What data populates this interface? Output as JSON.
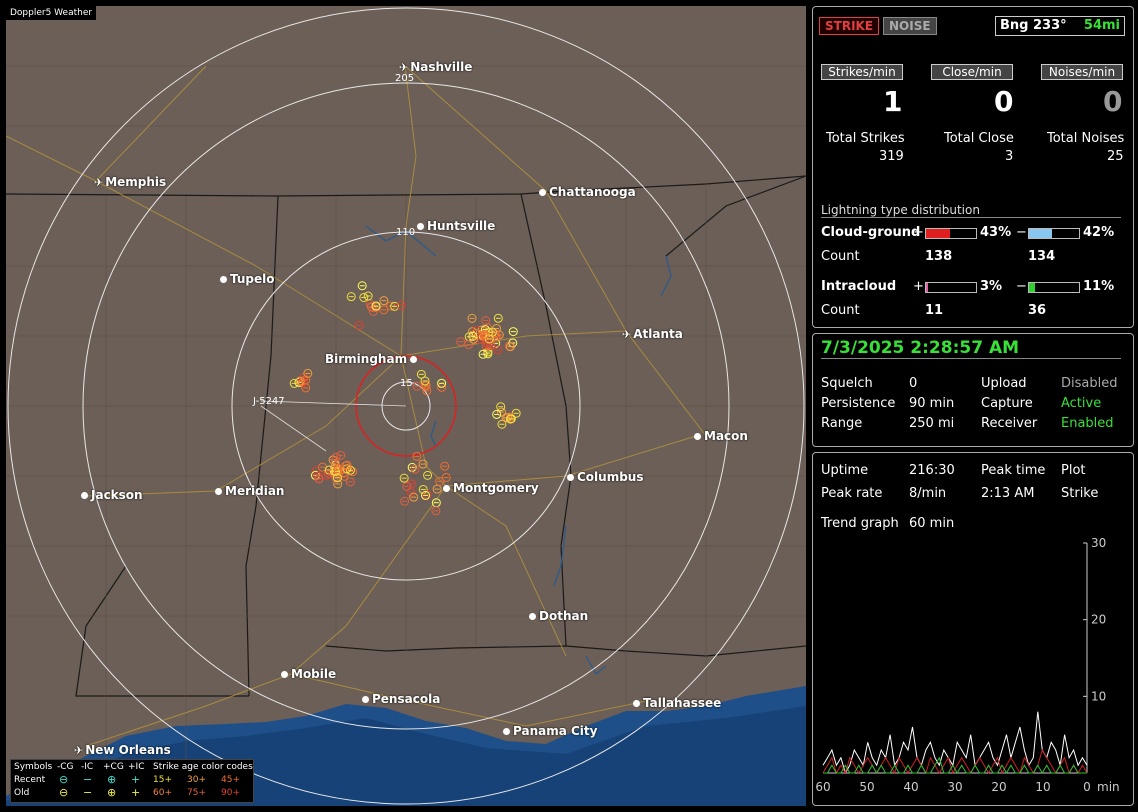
{
  "map": {
    "title": "Doppler5 Weather",
    "ring_labels": {
      "r205": "205",
      "r110": "110",
      "r15": "15"
    },
    "marker_label": "J-5247",
    "cities": [
      {
        "name": "Nashville",
        "kind": "airport"
      },
      {
        "name": "Memphis",
        "kind": "airport"
      },
      {
        "name": "Chattanooga",
        "kind": "city"
      },
      {
        "name": "Huntsville",
        "kind": "city"
      },
      {
        "name": "Tupelo",
        "kind": "city"
      },
      {
        "name": "Atlanta",
        "kind": "airport"
      },
      {
        "name": "Birmingham",
        "kind": "city"
      },
      {
        "name": "Macon",
        "kind": "city"
      },
      {
        "name": "Jackson",
        "kind": "city"
      },
      {
        "name": "Meridian",
        "kind": "city"
      },
      {
        "name": "Montgomery",
        "kind": "city"
      },
      {
        "name": "Columbus",
        "kind": "city"
      },
      {
        "name": "Dothan",
        "kind": "city"
      },
      {
        "name": "Mobile",
        "kind": "city"
      },
      {
        "name": "Pensacola",
        "kind": "city"
      },
      {
        "name": "Tallahassee",
        "kind": "city"
      },
      {
        "name": "Panama City",
        "kind": "city"
      },
      {
        "name": "New Orleans",
        "kind": "airport"
      }
    ],
    "legend": {
      "symbols": "Symbols",
      "neg_cg": "-CG",
      "neg_ic": "-IC",
      "pos_cg": "+CG",
      "pos_ic": "+IC",
      "age_title": "Strike age color codes",
      "recent": "Recent",
      "old": "Old",
      "recent_ages": [
        "15+",
        "30+",
        "45+"
      ],
      "old_ages": [
        "60+",
        "75+",
        "90+"
      ],
      "colors": {
        "recent": "#3fe0d0",
        "old": "#f0f040",
        "a15": "#f0e040",
        "a30": "#f0a040",
        "a45": "#f07030",
        "a60": "#f08040",
        "a75": "#e06040",
        "a90": "#e04030"
      }
    }
  },
  "top": {
    "strike": "STRIKE",
    "noise": "NOISE",
    "bearing": "Bng 233°",
    "distance": "54mi",
    "strikes_hdr": "Strikes/min",
    "close_hdr": "Close/min",
    "noises_hdr": "Noises/min",
    "strikes_val": "1",
    "close_val": "0",
    "noises_val": "0",
    "total_strikes_lbl": "Total Strikes",
    "total_close_lbl": "Total Close",
    "total_noises_lbl": "Total Noises",
    "total_strikes": "319",
    "total_close": "3",
    "total_noises": "25",
    "dist_title": "Lightning type distribution",
    "cg_lbl": "Cloud-ground",
    "ic_lbl": "Intracloud",
    "count_lbl": "Count",
    "plus": "+",
    "minus": "−",
    "cg_pos_pct": "43%",
    "cg_neg_pct": "42%",
    "cg_pos_count": "138",
    "cg_neg_count": "134",
    "ic_pos_pct": "3%",
    "ic_neg_pct": "11%",
    "ic_pos_count": "11",
    "ic_neg_count": "36",
    "cg_pos_frac": 0.43,
    "cg_neg_frac": 0.42,
    "ic_pos_frac": 0.03,
    "ic_neg_frac": 0.11
  },
  "status": {
    "datetime": "7/3/2025 2:28:57 AM",
    "squelch_lbl": "Squelch",
    "squelch": "0",
    "persistence_lbl": "Persistence",
    "persistence": "90 min",
    "range_lbl": "Range",
    "range": "250 mi",
    "upload_lbl": "Upload",
    "upload": "Disabled",
    "capture_lbl": "Capture",
    "capture": "Active",
    "receiver_lbl": "Receiver",
    "receiver": "Enabled"
  },
  "stats": {
    "uptime_lbl": "Uptime",
    "uptime": "216:30",
    "peak_time_lbl": "Peak time",
    "peak_time": "2:13 AM",
    "plot_lbl": "Plot",
    "plot": "Strike",
    "peak_rate_lbl": "Peak rate",
    "peak_rate": "8/min",
    "trend_lbl": "Trend graph",
    "trend": "60 min"
  },
  "chart_data": {
    "type": "line",
    "x_ticks": [
      "60",
      "50",
      "40",
      "30",
      "20",
      "10",
      "0"
    ],
    "x_unit": "min",
    "y_ticks": [
      "30",
      "20",
      "10"
    ],
    "ylim": [
      0,
      30
    ],
    "xlim": [
      60,
      0
    ],
    "series": [
      {
        "color": "#ffffff",
        "values": [
          1,
          2,
          3,
          1,
          2,
          0,
          1,
          3,
          2,
          1,
          4,
          2,
          1,
          3,
          2,
          5,
          1,
          2,
          4,
          3,
          6,
          2,
          1,
          3,
          4,
          2,
          1,
          3,
          2,
          1,
          4,
          3,
          2,
          5,
          1,
          2,
          3,
          4,
          2,
          1,
          3,
          5,
          2,
          4,
          6,
          3,
          1,
          2,
          8,
          3,
          2,
          4,
          3,
          1,
          5,
          2,
          3,
          1,
          2,
          1
        ]
      },
      {
        "color": "#d02020",
        "values": [
          0,
          1,
          2,
          0,
          1,
          0,
          2,
          1,
          0,
          1,
          2,
          1,
          0,
          1,
          2,
          1,
          0,
          2,
          1,
          0,
          1,
          2,
          1,
          0,
          2,
          1,
          0,
          1,
          2,
          0,
          1,
          2,
          1,
          0,
          1,
          2,
          1,
          0,
          1,
          2,
          0,
          1,
          2,
          1,
          0,
          2,
          1,
          0,
          1,
          3,
          2,
          1,
          0,
          1,
          2,
          0,
          1,
          0,
          1,
          0
        ]
      },
      {
        "color": "#30c030",
        "values": [
          0,
          0,
          1,
          0,
          0,
          1,
          0,
          0,
          1,
          0,
          0,
          1,
          0,
          1,
          0,
          0,
          1,
          0,
          0,
          1,
          0,
          0,
          1,
          0,
          0,
          1,
          2,
          0,
          0,
          1,
          0,
          1,
          0,
          0,
          1,
          0,
          0,
          1,
          0,
          0,
          1,
          0,
          1,
          0,
          0,
          1,
          0,
          0,
          1,
          0,
          1,
          0,
          0,
          1,
          0,
          0,
          1,
          0,
          0,
          0
        ]
      }
    ]
  }
}
